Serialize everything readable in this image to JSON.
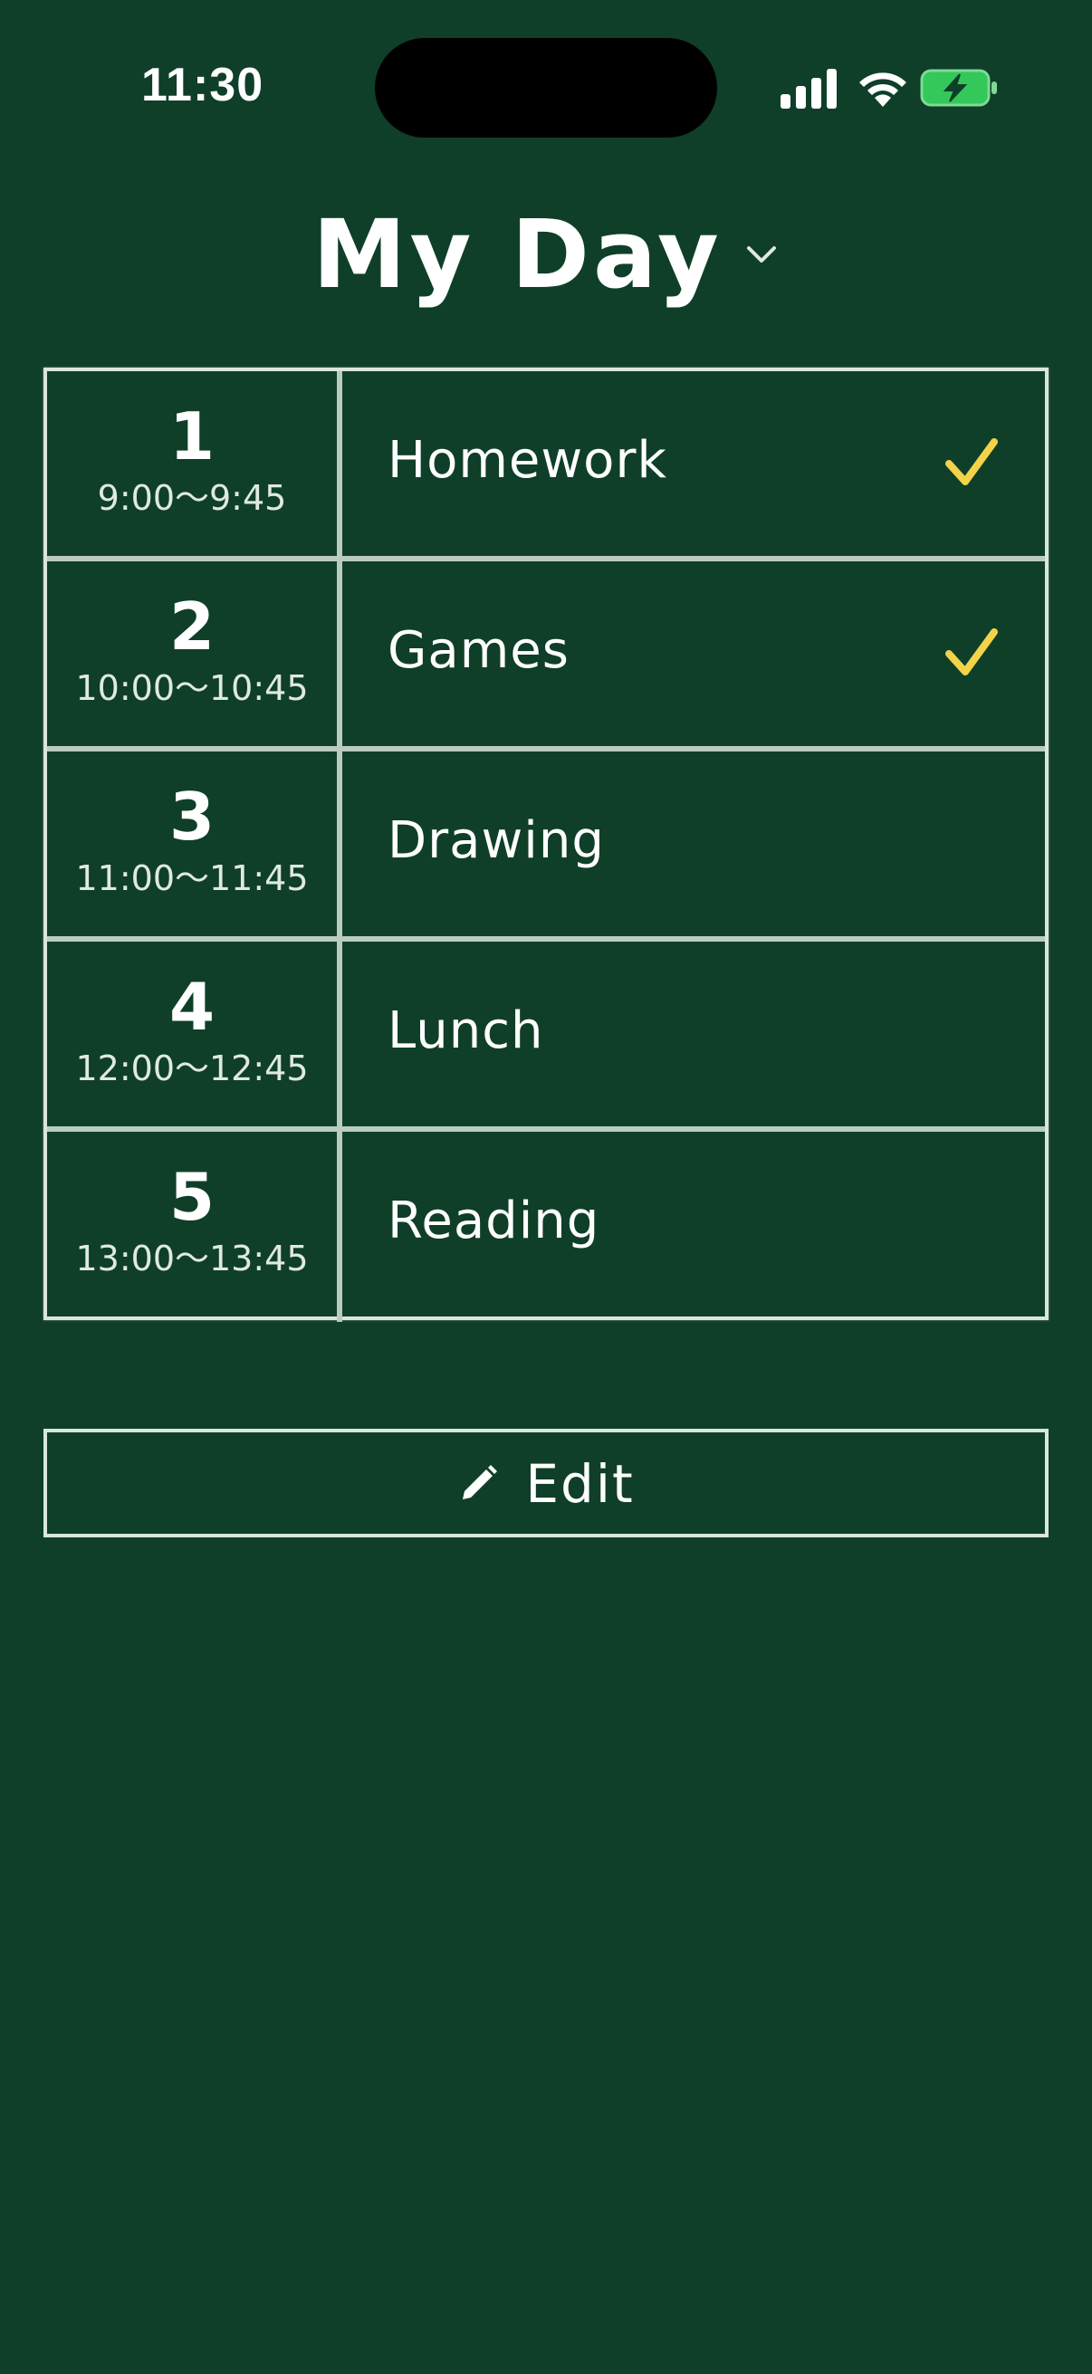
{
  "status_bar": {
    "time": "11:30",
    "icons": [
      "cellular-signal-icon",
      "wifi-icon",
      "battery-charging-icon"
    ],
    "battery_color": "#34c759"
  },
  "header": {
    "title": "My Day",
    "dropdown_icon": "chevron-down-icon"
  },
  "schedule": {
    "rows": [
      {
        "period": "1",
        "time": "9:00〜9:45",
        "activity": "Homework",
        "done": true
      },
      {
        "period": "2",
        "time": "10:00〜10:45",
        "activity": "Games",
        "done": true
      },
      {
        "period": "3",
        "time": "11:00〜11:45",
        "activity": "Drawing",
        "done": false
      },
      {
        "period": "4",
        "time": "12:00〜12:45",
        "activity": "Lunch",
        "done": false
      },
      {
        "period": "5",
        "time": "13:00〜13:45",
        "activity": "Reading",
        "done": false
      }
    ],
    "check_icon": "checkmark-icon",
    "check_color": "#f2d34a"
  },
  "edit_button": {
    "label": "Edit",
    "icon": "pencil-icon"
  },
  "colors": {
    "background": "#0f3f28",
    "chalk_line": "#d9e6dc"
  }
}
